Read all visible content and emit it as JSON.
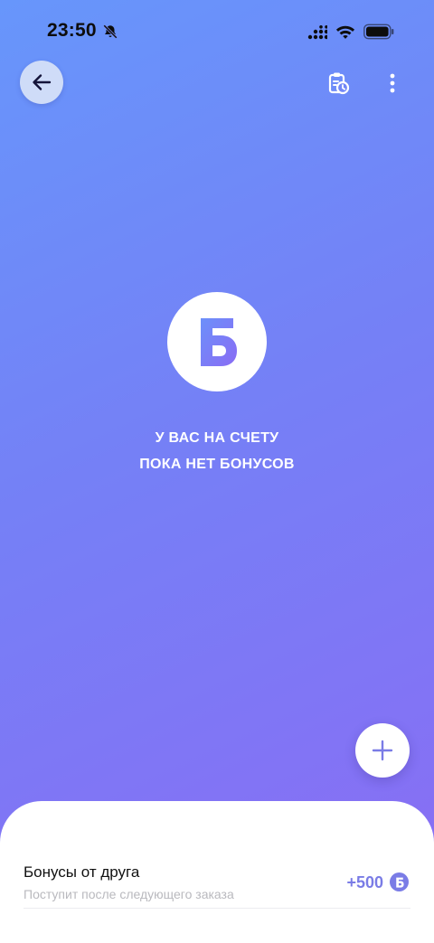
{
  "status_bar": {
    "time": "23:50"
  },
  "header": {
    "back_icon": "arrow-left-icon",
    "history_icon": "clipboard-clock-icon",
    "more_icon": "vertical-dots-icon"
  },
  "empty_state": {
    "logo_letter": "Б",
    "line1": "У ВАС НА СЧЕТУ",
    "line2": "ПОКА НЕТ БОНУСОВ"
  },
  "bonus_item": {
    "title": "Бонусы от друга",
    "subtitle": "Поступит после следующего заказа",
    "amount": "+500",
    "currency_letter": "Б"
  },
  "colors": {
    "gradient_start": "#6796fb",
    "gradient_end": "#8a6cf4",
    "accent": "#7a7ce6",
    "back_button_bg": "#cfdcf8"
  }
}
